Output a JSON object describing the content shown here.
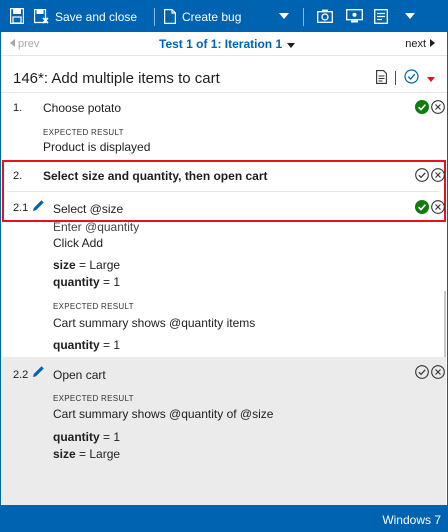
{
  "toolbar": {
    "save_close_label": "Save and close",
    "create_bug_label": "Create bug"
  },
  "nav": {
    "prev_label": "prev",
    "title": "Test 1 of 1: Iteration 1",
    "next_label": "next"
  },
  "test_title": "146*: Add multiple items to cart",
  "steps": [
    {
      "number": "1.",
      "text": "Choose potato",
      "expected_label": "EXPECTED RESULT",
      "expected": "Product is displayed",
      "status": "passed"
    },
    {
      "number": "2.",
      "text": "Select size and quantity, then open cart",
      "status": "none",
      "substeps": [
        {
          "number": "2.1",
          "lines": [
            "Select @size",
            "Enter @quantity",
            "Click Add"
          ],
          "params": [
            {
              "name": "size",
              "value": "Large"
            },
            {
              "name": "quantity",
              "value": "1"
            }
          ],
          "expected_label": "EXPECTED RESULT",
          "expected": "Cart summary shows @quantity items",
          "expected_params": [
            {
              "name": "quantity",
              "value": "1"
            }
          ],
          "status": "passed"
        },
        {
          "number": "2.2",
          "lines": [
            "Open cart"
          ],
          "expected_label": "EXPECTED RESULT",
          "expected": "Cart summary shows @quantity of @size",
          "expected_params": [
            {
              "name": "quantity",
              "value": "1"
            },
            {
              "name": "size",
              "value": "Large"
            }
          ],
          "status": "none"
        }
      ]
    }
  ],
  "param_sep": " = ",
  "status_bar": "Windows 7",
  "colors": {
    "accent": "#0063b1",
    "pass": "#107c10",
    "highlight": "#e81123"
  }
}
